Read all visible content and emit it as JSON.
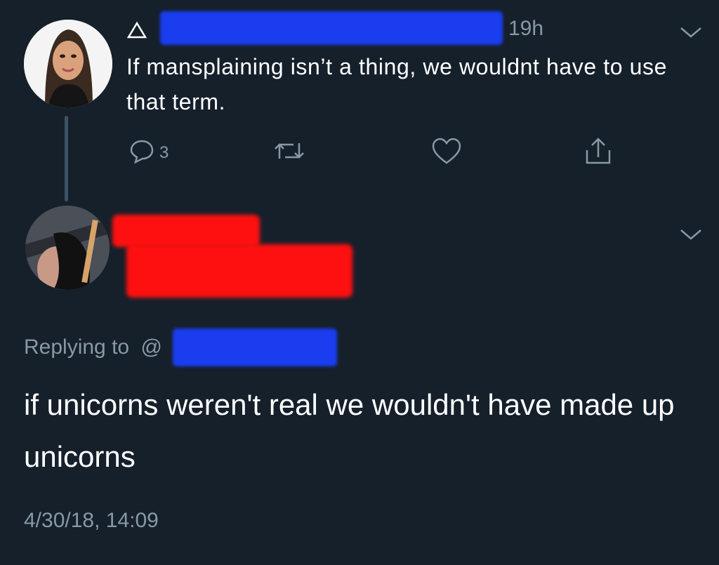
{
  "parent_tweet": {
    "time": "19h",
    "text": "If mansplaining isn’t a thing, we wouldnt have to use that term.",
    "reply_count": "3"
  },
  "reply_tweet": {
    "replying_label": "Replying to",
    "at_symbol": "@",
    "text": "if unicorns weren't real we wouldn't have made up unicorns",
    "timestamp": "4/30/18, 14:09"
  },
  "colors": {
    "background": "#15202b",
    "secondary_text": "#8899a6",
    "redaction_blue": "#1a3df0",
    "redaction_red": "#ff1010"
  },
  "icons": [
    "triangle-icon",
    "chevron-down-icon",
    "reply-icon",
    "retweet-icon",
    "like-icon",
    "share-icon"
  ]
}
